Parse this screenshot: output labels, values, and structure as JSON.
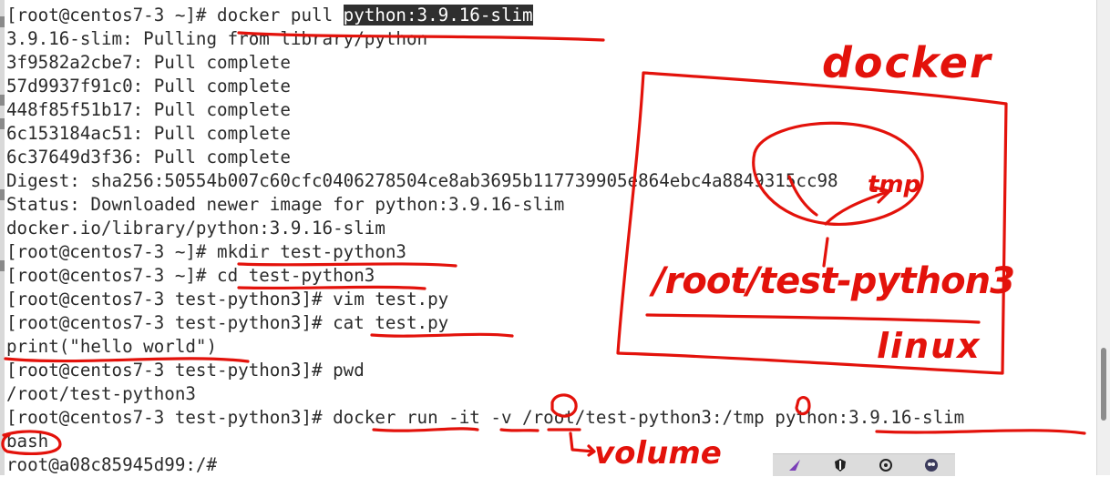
{
  "terminal": {
    "lines": [
      {
        "prompt": "[root@centos7-3 ~]# ",
        "cmd": "docker pull ",
        "highlight": "python:3.9.16-slim"
      },
      {
        "prompt": "",
        "cmd": "3.9.16-slim: Pulling from library/python",
        "highlight": ""
      },
      {
        "prompt": "",
        "cmd": "3f9582a2cbe7: Pull complete",
        "highlight": ""
      },
      {
        "prompt": "",
        "cmd": "57d9937f91c0: Pull complete",
        "highlight": ""
      },
      {
        "prompt": "",
        "cmd": "448f85f51b17: Pull complete",
        "highlight": ""
      },
      {
        "prompt": "",
        "cmd": "6c153184ac51: Pull complete",
        "highlight": ""
      },
      {
        "prompt": "",
        "cmd": "6c37649d3f36: Pull complete",
        "highlight": ""
      },
      {
        "prompt": "",
        "cmd": "Digest: sha256:50554b007c60cfc0406278504ce8ab3695b117739905e864ebc4a8849315cc98",
        "highlight": ""
      },
      {
        "prompt": "",
        "cmd": "Status: Downloaded newer image for python:3.9.16-slim",
        "highlight": ""
      },
      {
        "prompt": "",
        "cmd": "docker.io/library/python:3.9.16-slim",
        "highlight": ""
      },
      {
        "prompt": "[root@centos7-3 ~]# ",
        "cmd": "mkdir test-python3",
        "highlight": ""
      },
      {
        "prompt": "[root@centos7-3 ~]# ",
        "cmd": "cd test-python3",
        "highlight": ""
      },
      {
        "prompt": "[root@centos7-3 test-python3]# ",
        "cmd": "vim test.py",
        "highlight": ""
      },
      {
        "prompt": "[root@centos7-3 test-python3]# ",
        "cmd": "cat test.py",
        "highlight": ""
      },
      {
        "prompt": "",
        "cmd": "print(\"hello world\")",
        "highlight": ""
      },
      {
        "prompt": "[root@centos7-3 test-python3]# ",
        "cmd": "pwd",
        "highlight": ""
      },
      {
        "prompt": "",
        "cmd": "/root/test-python3",
        "highlight": ""
      },
      {
        "prompt": "[root@centos7-3 test-python3]# ",
        "cmd": "docker run -it -v /root/test-python3:/tmp python:3.9.16-slim",
        "highlight": ""
      },
      {
        "prompt": "",
        "cmd": "bash",
        "highlight": ""
      },
      {
        "prompt": "",
        "cmd": "root@a08c85945d99:/# ",
        "highlight": ""
      }
    ]
  },
  "annotations": {
    "color": "#e3120b",
    "docker": "docker",
    "tmp": "tmp",
    "host_path": "/root/test-python3",
    "linux": "linux",
    "volume": "volume"
  },
  "panel": {
    "icons": [
      "arrow-icon",
      "shield-icon",
      "circle-icon",
      "game-icon"
    ]
  }
}
